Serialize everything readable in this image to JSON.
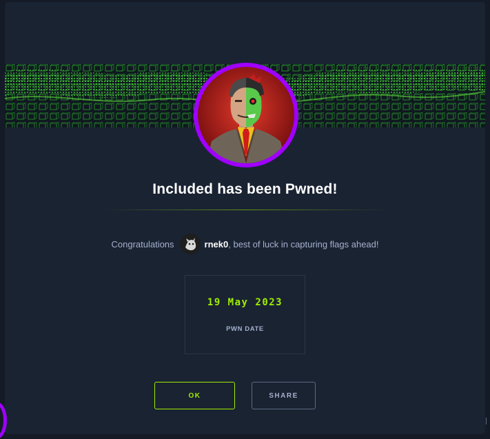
{
  "modal": {
    "title": "Included has been Pwned!",
    "congrats_prefix": "Congratulations",
    "username": "rnek0",
    "congrats_suffix": ", best of luck in capturing flags ahead!",
    "pwn_date": "19 May 2023",
    "pwn_date_label": "PWN DATE",
    "ok_label": "OK",
    "share_label": "SHARE"
  },
  "colors": {
    "background": "#1a2332",
    "accent_green": "#9fef00",
    "avatar_ring": "#9f00ff",
    "muted_text": "#a4b1cd"
  },
  "icons": {
    "machine_avatar": "half-man-half-villain-avatar",
    "user_avatar": "user-avatar"
  }
}
